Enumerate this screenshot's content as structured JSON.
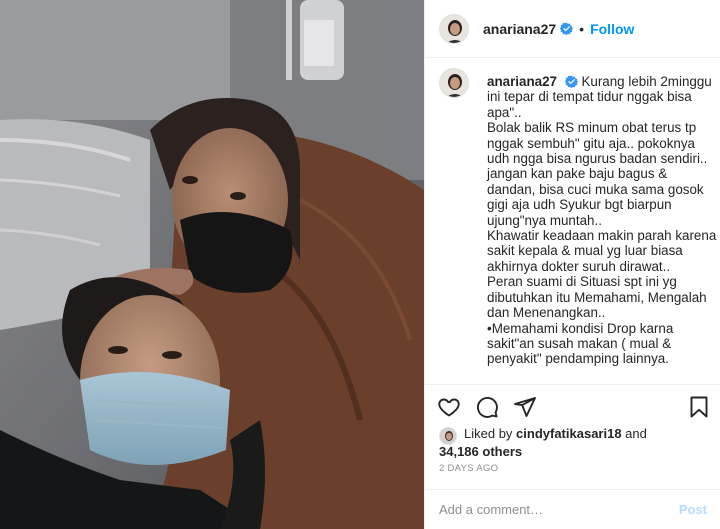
{
  "post": {
    "username": "anariana27",
    "verified": true,
    "dot": "•",
    "follow_label": "Follow"
  },
  "caption": {
    "username": "anariana27",
    "lines": [
      "Kurang lebih 2minggu",
      "ini tepar di tempat tidur nggak bisa",
      "apa\"..",
      "Bolak balik RS minum obat terus tp",
      "nggak sembuh\" gitu aja.. pokoknya",
      "udh ngga bisa ngurus badan sendiri..",
      "jangan kan pake baju bagus &",
      "dandan, bisa cuci muka sama gosok",
      "gigi aja udh Syukur bgt biarpun",
      "ujung\"nya muntah..",
      "Khawatir keadaan makin parah karena",
      "sakit kepala & mual yg luar biasa",
      "akhirnya dokter suruh dirawat..",
      "Peran suami di Situasi spt ini yg",
      "dibutuhkan itu Memahami, Mengalah",
      "dan Menenangkan..",
      "•Memahami kondisi Drop karna",
      "sakit\"an susah makan ( mual &",
      "penyakit\" pendamping lainnya."
    ]
  },
  "actions": {
    "like_icon": "heart-icon",
    "comment_icon": "comment-icon",
    "share_icon": "share-icon",
    "save_icon": "bookmark-icon"
  },
  "likes": {
    "prefix": "Liked by ",
    "liker": "cindyfatikasari18",
    "conjunction": " and",
    "count_text": "34,186 others"
  },
  "timestamp": "2 DAYS AGO",
  "comment_box": {
    "placeholder": "Add a comment…",
    "post_label": "Post"
  },
  "colors": {
    "accent": "#0095f6",
    "post_disabled": "#b3dbff",
    "muted": "#8e8e8e",
    "divider": "#efefef"
  }
}
